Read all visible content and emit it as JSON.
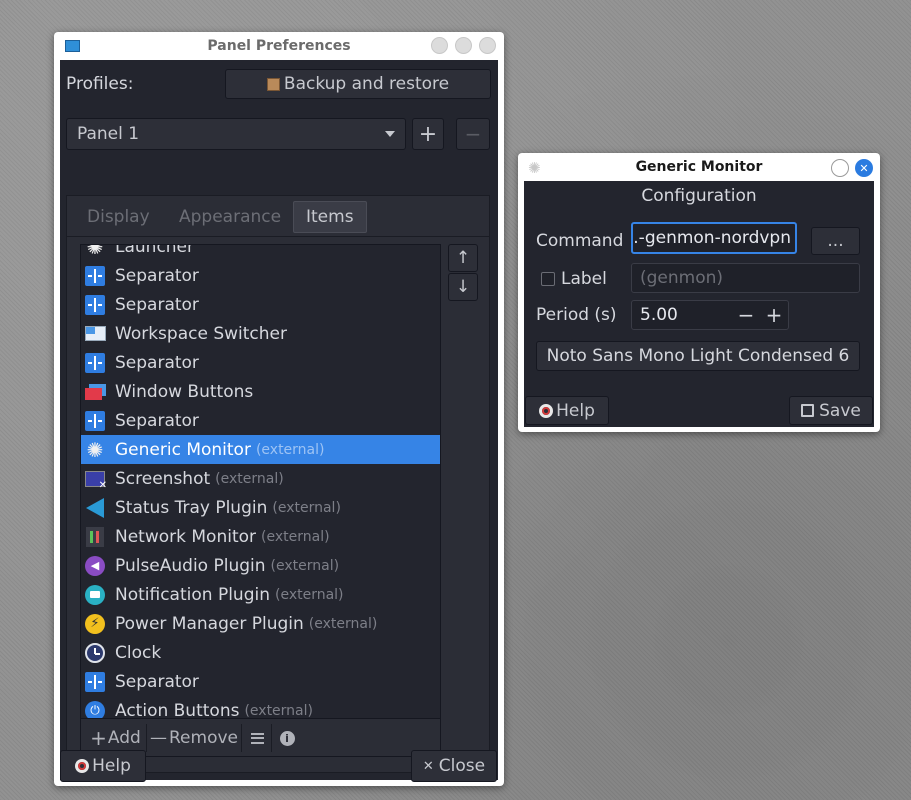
{
  "panel_prefs": {
    "title": "Panel Preferences",
    "profiles_label": "Profiles:",
    "backup_button": "Backup and restore",
    "panel_select": "Panel 1",
    "add_symbol": "+",
    "remove_symbol": "−",
    "tabs": [
      {
        "label": "Display"
      },
      {
        "label": "Appearance"
      },
      {
        "label": "Items"
      }
    ],
    "active_tab": "Items",
    "move_up": "↑",
    "move_down": "↓",
    "items": [
      {
        "label": "Launcher",
        "ext": "",
        "icon": "gear-icon"
      },
      {
        "label": "Separator",
        "ext": "",
        "icon": "separator-icon"
      },
      {
        "label": "Separator",
        "ext": "",
        "icon": "separator-icon"
      },
      {
        "label": "Workspace Switcher",
        "ext": "",
        "icon": "workspace-icon"
      },
      {
        "label": "Separator",
        "ext": "",
        "icon": "separator-icon"
      },
      {
        "label": "Window Buttons",
        "ext": "",
        "icon": "window-buttons-icon"
      },
      {
        "label": "Separator",
        "ext": "",
        "icon": "separator-icon"
      },
      {
        "label": "Generic Monitor",
        "ext": "(external)",
        "icon": "gear-icon"
      },
      {
        "label": "Screenshot",
        "ext": "(external)",
        "icon": "screenshot-icon"
      },
      {
        "label": "Status Tray Plugin",
        "ext": "(external)",
        "icon": "megaphone-icon"
      },
      {
        "label": "Network Monitor",
        "ext": "(external)",
        "icon": "network-icon"
      },
      {
        "label": "PulseAudio Plugin",
        "ext": "(external)",
        "icon": "speaker-icon"
      },
      {
        "label": "Notification Plugin",
        "ext": "(external)",
        "icon": "chat-bubble-icon"
      },
      {
        "label": "Power Manager Plugin",
        "ext": "(external)",
        "icon": "lightning-icon"
      },
      {
        "label": "Clock",
        "ext": "",
        "icon": "clock-icon"
      },
      {
        "label": "Separator",
        "ext": "",
        "icon": "separator-icon"
      },
      {
        "label": "Action Buttons",
        "ext": "(external)",
        "icon": "power-icon"
      }
    ],
    "selected_item": "Generic Monitor",
    "add_button": "Add",
    "remove_button": "Remove",
    "help_button": "Help",
    "close_button": "Close"
  },
  "generic_monitor": {
    "title": "Generic Monitor",
    "section_title": "Configuration",
    "command_label": "Command",
    "command_value": ".-genmon-nordvpn",
    "browse_button": "...",
    "label_checkbox": "Label",
    "label_placeholder": "(genmon)",
    "period_label": "Period (s)",
    "period_value": "5.00",
    "decrement_symbol": "−",
    "increment_symbol": "+",
    "font_button": "Noto Sans Mono Light Condensed 6",
    "help_button": "Help",
    "save_button": "Save"
  },
  "colors": {
    "selection": "#3684e6",
    "background_dark": "#23252e",
    "close_button_blue": "#2a7be0"
  }
}
